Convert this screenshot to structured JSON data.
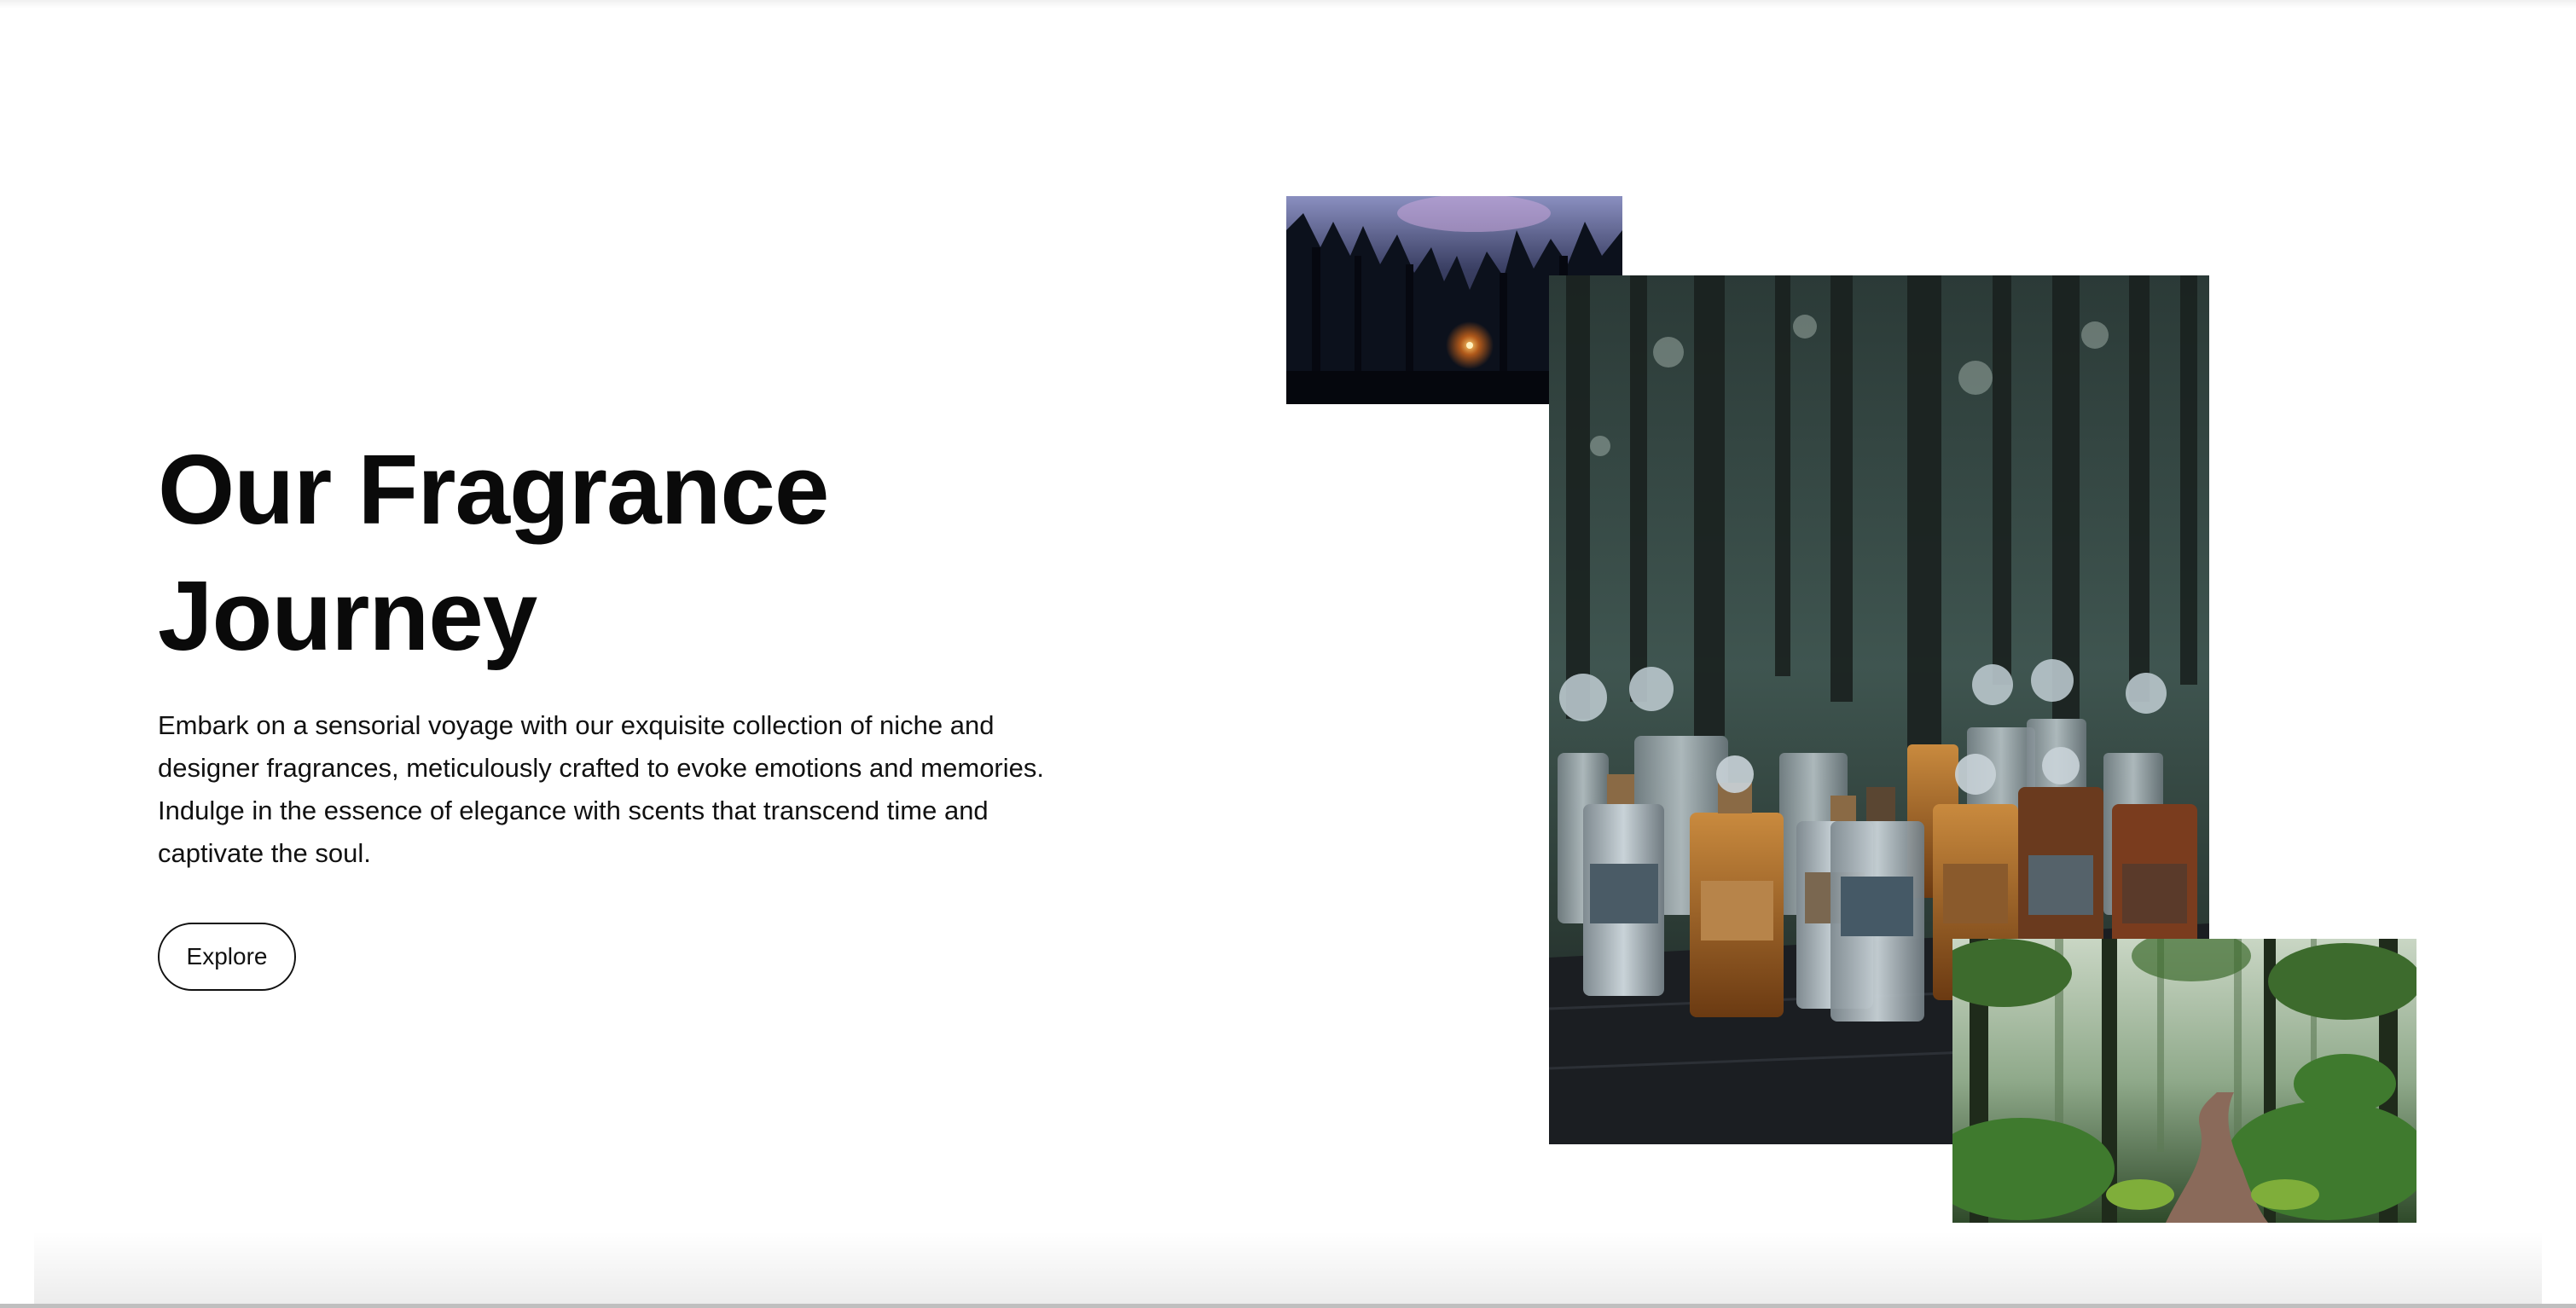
{
  "hero": {
    "title_line1": "Our Fragrance",
    "title_line2": "Journey",
    "description": "Embark on a sensorial voyage with our exquisite collection of niche and designer fragrances, meticulously crafted to evoke emotions and memories. Indulge in the essence of elegance with scents that transcend time and captivate the soul.",
    "cta_label": "Explore"
  },
  "images": {
    "small": "forest-sunset-image",
    "main": "perfume-bottles-forest-image",
    "forest": "green-forest-path-image"
  },
  "colors": {
    "text": "#0a0a0a",
    "background": "#ffffff",
    "button_border": "#111111"
  }
}
